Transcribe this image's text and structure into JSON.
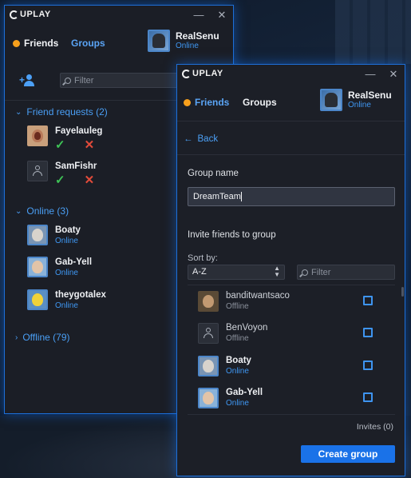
{
  "brand": "UPLAY",
  "colors": {
    "accent": "#1a72e8",
    "online": "#3f97f2",
    "accept": "#3ec356",
    "decline": "#e24b3a",
    "status_dot": "#f7a01c"
  },
  "window_controls": {
    "minimize": "—",
    "close": "✕"
  },
  "friends_window": {
    "tabs": {
      "friends": "Friends",
      "groups": "Groups"
    },
    "user": {
      "name": "RealSenu",
      "status": "Online"
    },
    "filter_placeholder": "Filter",
    "friend_requests": {
      "header": "Friend requests (2)",
      "items": [
        {
          "name": "Fayelauleg",
          "icon": "avatar-woman"
        },
        {
          "name": "SamFishr",
          "icon": "avatar-placeholder"
        }
      ]
    },
    "online": {
      "header": "Online (3)",
      "items": [
        {
          "name": "Boaty",
          "status": "Online"
        },
        {
          "name": "Gab-Yell",
          "status": "Online"
        },
        {
          "name": "theygotalex",
          "status": "Online"
        }
      ]
    },
    "offline": {
      "header": "Offline (79)"
    }
  },
  "group_window": {
    "tabs": {
      "friends": "Friends",
      "groups": "Groups"
    },
    "user": {
      "name": "RealSenu",
      "status": "Online"
    },
    "back_label": "Back",
    "group_name_label": "Group name",
    "group_name_value": "DreamTeam",
    "invite_label": "Invite friends to group",
    "sort_label": "Sort by:",
    "sort_value": "A-Z",
    "filter_placeholder": "Filter",
    "friends": [
      {
        "name": "banditwantsaco",
        "status": "Offline"
      },
      {
        "name": "BenVoyon",
        "status": "Offline"
      },
      {
        "name": "Boaty",
        "status": "Online"
      },
      {
        "name": "Gab-Yell",
        "status": "Online"
      }
    ],
    "invites_label": "Invites (0)",
    "create_label": "Create group"
  }
}
